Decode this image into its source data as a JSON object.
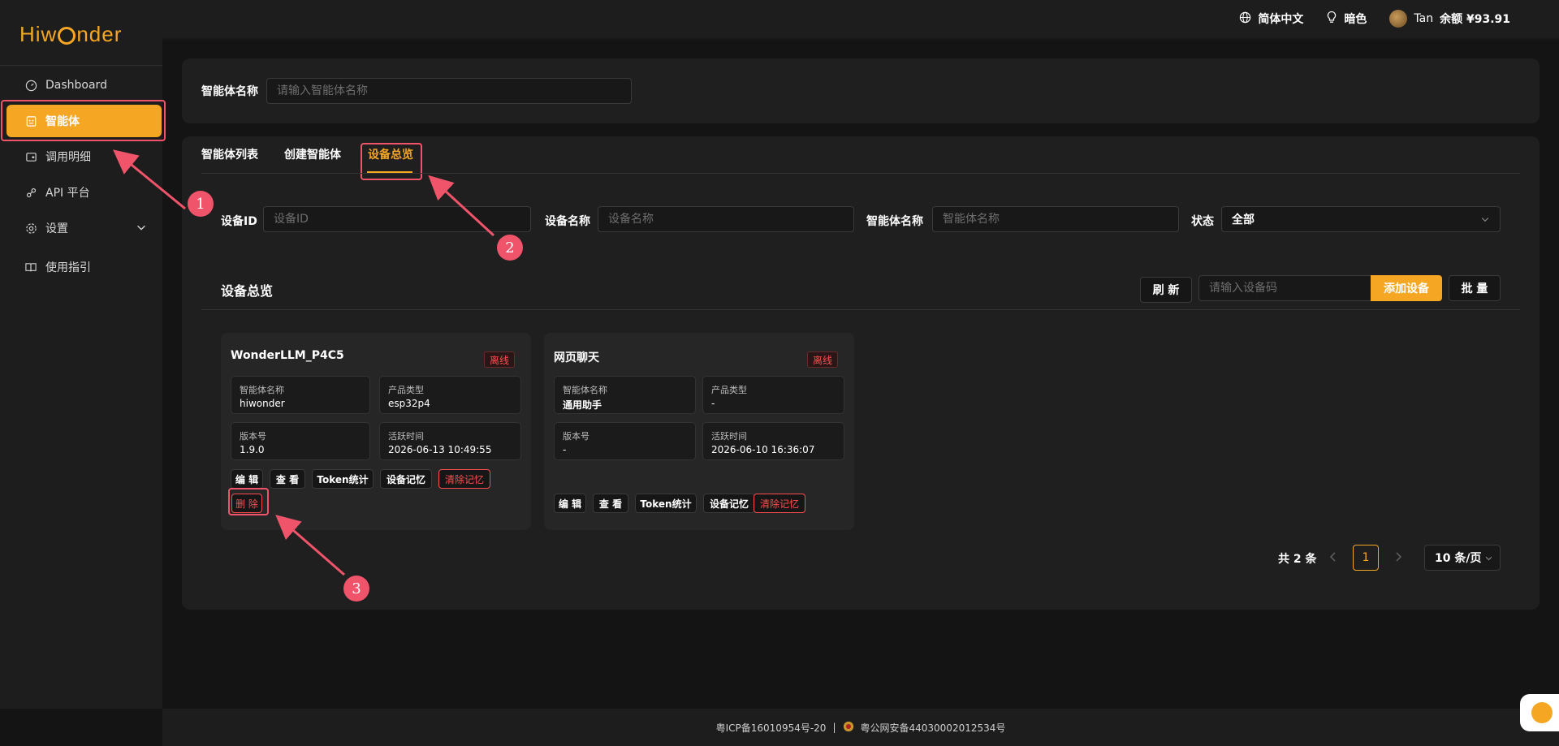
{
  "brand": {
    "logo_text": "Hiwonder"
  },
  "topbar": {
    "language": "简体中文",
    "theme": "暗色",
    "user": "Tan",
    "balance": "余额 ¥93.91"
  },
  "sidebar": {
    "items": [
      {
        "label": "Dashboard",
        "icon": "gauge-icon"
      },
      {
        "label": "智能体",
        "icon": "robot-icon",
        "active": true
      },
      {
        "label": "调用明细",
        "icon": "wallet-icon"
      },
      {
        "label": "API 平台",
        "icon": "api-icon"
      },
      {
        "label": "设置",
        "icon": "gear-icon"
      },
      {
        "label": "使用指引",
        "icon": "book-icon"
      }
    ]
  },
  "search": {
    "label": "智能体名称",
    "placeholder": "请输入智能体名称"
  },
  "tabs": [
    {
      "label": "智能体列表"
    },
    {
      "label": "创建智能体"
    },
    {
      "label": "设备总览",
      "active": true
    }
  ],
  "filters": {
    "device_id": {
      "label": "设备ID",
      "placeholder": "设备ID"
    },
    "device_name": {
      "label": "设备名称",
      "placeholder": "设备名称"
    },
    "agent_name": {
      "label": "智能体名称",
      "placeholder": "智能体名称"
    },
    "status": {
      "label": "状态",
      "value": "全部"
    }
  },
  "overview": {
    "title": "设备总览",
    "refresh_label": "刷 新",
    "code_placeholder": "请输入设备码",
    "add_label": "添加设备",
    "batch_label": "批 量"
  },
  "devices": [
    {
      "name": "WonderLLM_P4C5",
      "status": "离线",
      "agent_label": "智能体名称",
      "agent": "hiwonder",
      "type_label": "产品类型",
      "type": "esp32p4",
      "version_label": "版本号",
      "version": "1.9.0",
      "active_label": "活跃时间",
      "active_time": "2026-06-13 10:49:55"
    },
    {
      "name": "网页聊天",
      "status": "离线",
      "agent_label": "智能体名称",
      "agent": "通用助手",
      "type_label": "产品类型",
      "type": "-",
      "version_label": "版本号",
      "version": "-",
      "active_label": "活跃时间",
      "active_time": "2026-06-10 16:36:07"
    }
  ],
  "actions": {
    "edit": "编 辑",
    "view": "查 看",
    "token": "Token统计",
    "memory": "设备记忆",
    "clear": "清除记忆",
    "delete": "删 除"
  },
  "pagination": {
    "total": "共 2 条",
    "current": "1",
    "page_size": "10 条/页"
  },
  "callouts": [
    "1",
    "2",
    "3"
  ],
  "footer": {
    "icp": "粤ICP备16010954号-20",
    "sep": "|",
    "police": "粤公网安备44030002012534号"
  },
  "colors": {
    "accent": "#f5a623",
    "danger": "#ff4d4f",
    "highlight": "#f0546a",
    "bg": "#141414",
    "panel": "#1f1f1f"
  }
}
